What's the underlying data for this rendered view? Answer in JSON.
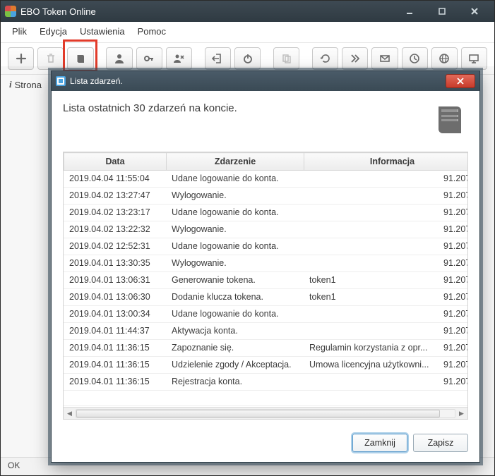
{
  "app_title": "EBO Token Online",
  "menu": {
    "file": "Plik",
    "edit": "Edycja",
    "settings": "Ustawienia",
    "help": "Pomoc"
  },
  "status_label": "Strona",
  "footer_status": "OK",
  "modal": {
    "title": "Lista zdarzeń.",
    "heading": "Lista ostatnich 30 zdarzeń na koncie.",
    "columns": {
      "date": "Data",
      "event": "Zdarzenie",
      "info": "Informacja"
    },
    "rows": [
      {
        "date": "2019.04.04 11:55:04",
        "event": "Udane logowanie do konta.",
        "info": "",
        "ip": "91.207"
      },
      {
        "date": "2019.04.02 13:27:47",
        "event": "Wylogowanie.",
        "info": "",
        "ip": "91.207"
      },
      {
        "date": "2019.04.02 13:23:17",
        "event": "Udane logowanie do konta.",
        "info": "",
        "ip": "91.207"
      },
      {
        "date": "2019.04.02 13:22:32",
        "event": "Wylogowanie.",
        "info": "",
        "ip": "91.207"
      },
      {
        "date": "2019.04.02 12:52:31",
        "event": "Udane logowanie do konta.",
        "info": "",
        "ip": "91.207"
      },
      {
        "date": "2019.04.01 13:30:35",
        "event": "Wylogowanie.",
        "info": "",
        "ip": "91.207"
      },
      {
        "date": "2019.04.01 13:06:31",
        "event": "Generowanie tokena.",
        "info": "token1",
        "ip": "91.207"
      },
      {
        "date": "2019.04.01 13:06:30",
        "event": "Dodanie klucza tokena.",
        "info": "token1",
        "ip": "91.207"
      },
      {
        "date": "2019.04.01 13:00:34",
        "event": "Udane logowanie do konta.",
        "info": "",
        "ip": "91.207"
      },
      {
        "date": "2019.04.01 11:44:37",
        "event": "Aktywacja konta.",
        "info": "",
        "ip": "91.207"
      },
      {
        "date": "2019.04.01 11:36:15",
        "event": "Zapoznanie się.",
        "info": "Regulamin korzystania z opr...",
        "ip": "91.207"
      },
      {
        "date": "2019.04.01 11:36:15",
        "event": "Udzielenie zgody / Akceptacja.",
        "info": "Umowa licencyjna użytkowni...",
        "ip": "91.207"
      },
      {
        "date": "2019.04.01 11:36:15",
        "event": "Rejestracja konta.",
        "info": "",
        "ip": "91.207"
      }
    ],
    "close_btn": "Zamknij",
    "save_btn": "Zapisz"
  }
}
